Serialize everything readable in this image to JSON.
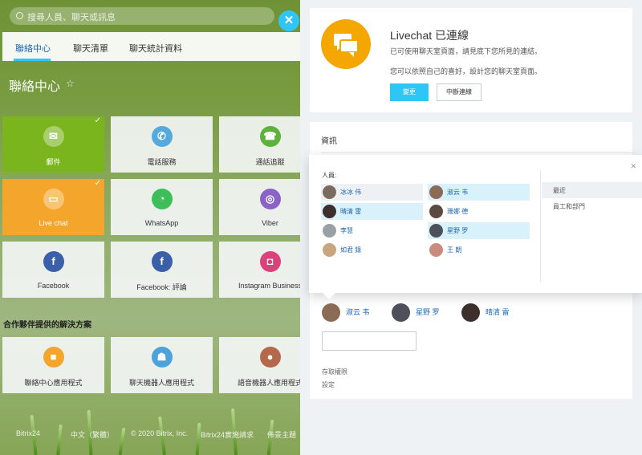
{
  "header": {
    "search_placeholder": "搜尋人員、聊天或訊息"
  },
  "tabs": [
    {
      "label": "聯絡中心"
    },
    {
      "label": "聊天清單"
    },
    {
      "label": "聊天統計資料"
    }
  ],
  "contact_center": {
    "title": "聯絡中心",
    "tiles": [
      {
        "label": "郵件",
        "icon": "mail-icon"
      },
      {
        "label": "電話服務",
        "icon": "phone-icon"
      },
      {
        "label": "通話追蹤",
        "icon": "call-tracking-icon"
      },
      {
        "label": "Live chat",
        "icon": "chat-icon"
      },
      {
        "label": "WhatsApp",
        "icon": "whatsapp-icon"
      },
      {
        "label": "Viber",
        "icon": "viber-icon"
      },
      {
        "label": "Facebook",
        "icon": "facebook-icon"
      },
      {
        "label": "Facebook: 評論",
        "icon": "facebook-comments-icon"
      },
      {
        "label": "Instagram Business",
        "icon": "instagram-icon"
      }
    ],
    "partner_section": "合作夥伴提供的解決方案",
    "partner_tiles": [
      {
        "label": "聯絡中心應用程式",
        "icon": "box-icon"
      },
      {
        "label": "聊天機器人應用程式",
        "icon": "android-icon"
      },
      {
        "label": "語音機器人應用程式",
        "icon": "microphone-icon"
      }
    ]
  },
  "footer": {
    "items": [
      "Bitrix24",
      "中文（繁體）",
      "© 2020 Bitrix, Inc.",
      "Bitrix24實施請求",
      "佈景主題"
    ]
  },
  "livechat": {
    "title": "Livechat 已連線",
    "line1": "已可使用聊天室頁面，請見底下您所見的連結。",
    "line2": "您可以依照自己的喜好，設計您的聊天室頁面。",
    "btn_change": "變更",
    "btn_disconnect": "中斷連線"
  },
  "info": {
    "title": "資訊",
    "popup": {
      "label": "人員:",
      "people": [
        {
          "name": "冰冰 伟"
        },
        {
          "name": "淑云 韦"
        },
        {
          "name": "晴清 雷"
        },
        {
          "name": "珊娜 德"
        },
        {
          "name": "李慧"
        },
        {
          "name": "星野 罗"
        },
        {
          "name": "如君 錄"
        },
        {
          "name": "王 朗"
        }
      ],
      "menu": [
        {
          "label": "最近"
        },
        {
          "label": "員工和部門"
        }
      ]
    },
    "selected": [
      {
        "name": "淑云 韦"
      },
      {
        "name": "星野 罗"
      },
      {
        "name": "晴清 雷"
      }
    ],
    "access_link": "存取權限",
    "settings_link": "設定"
  },
  "colors": {
    "accent": "#2fc6f6",
    "link": "#2067b0",
    "livechat": "#f4a700",
    "green": "#7ab51d",
    "orange": "#f4a52c"
  }
}
